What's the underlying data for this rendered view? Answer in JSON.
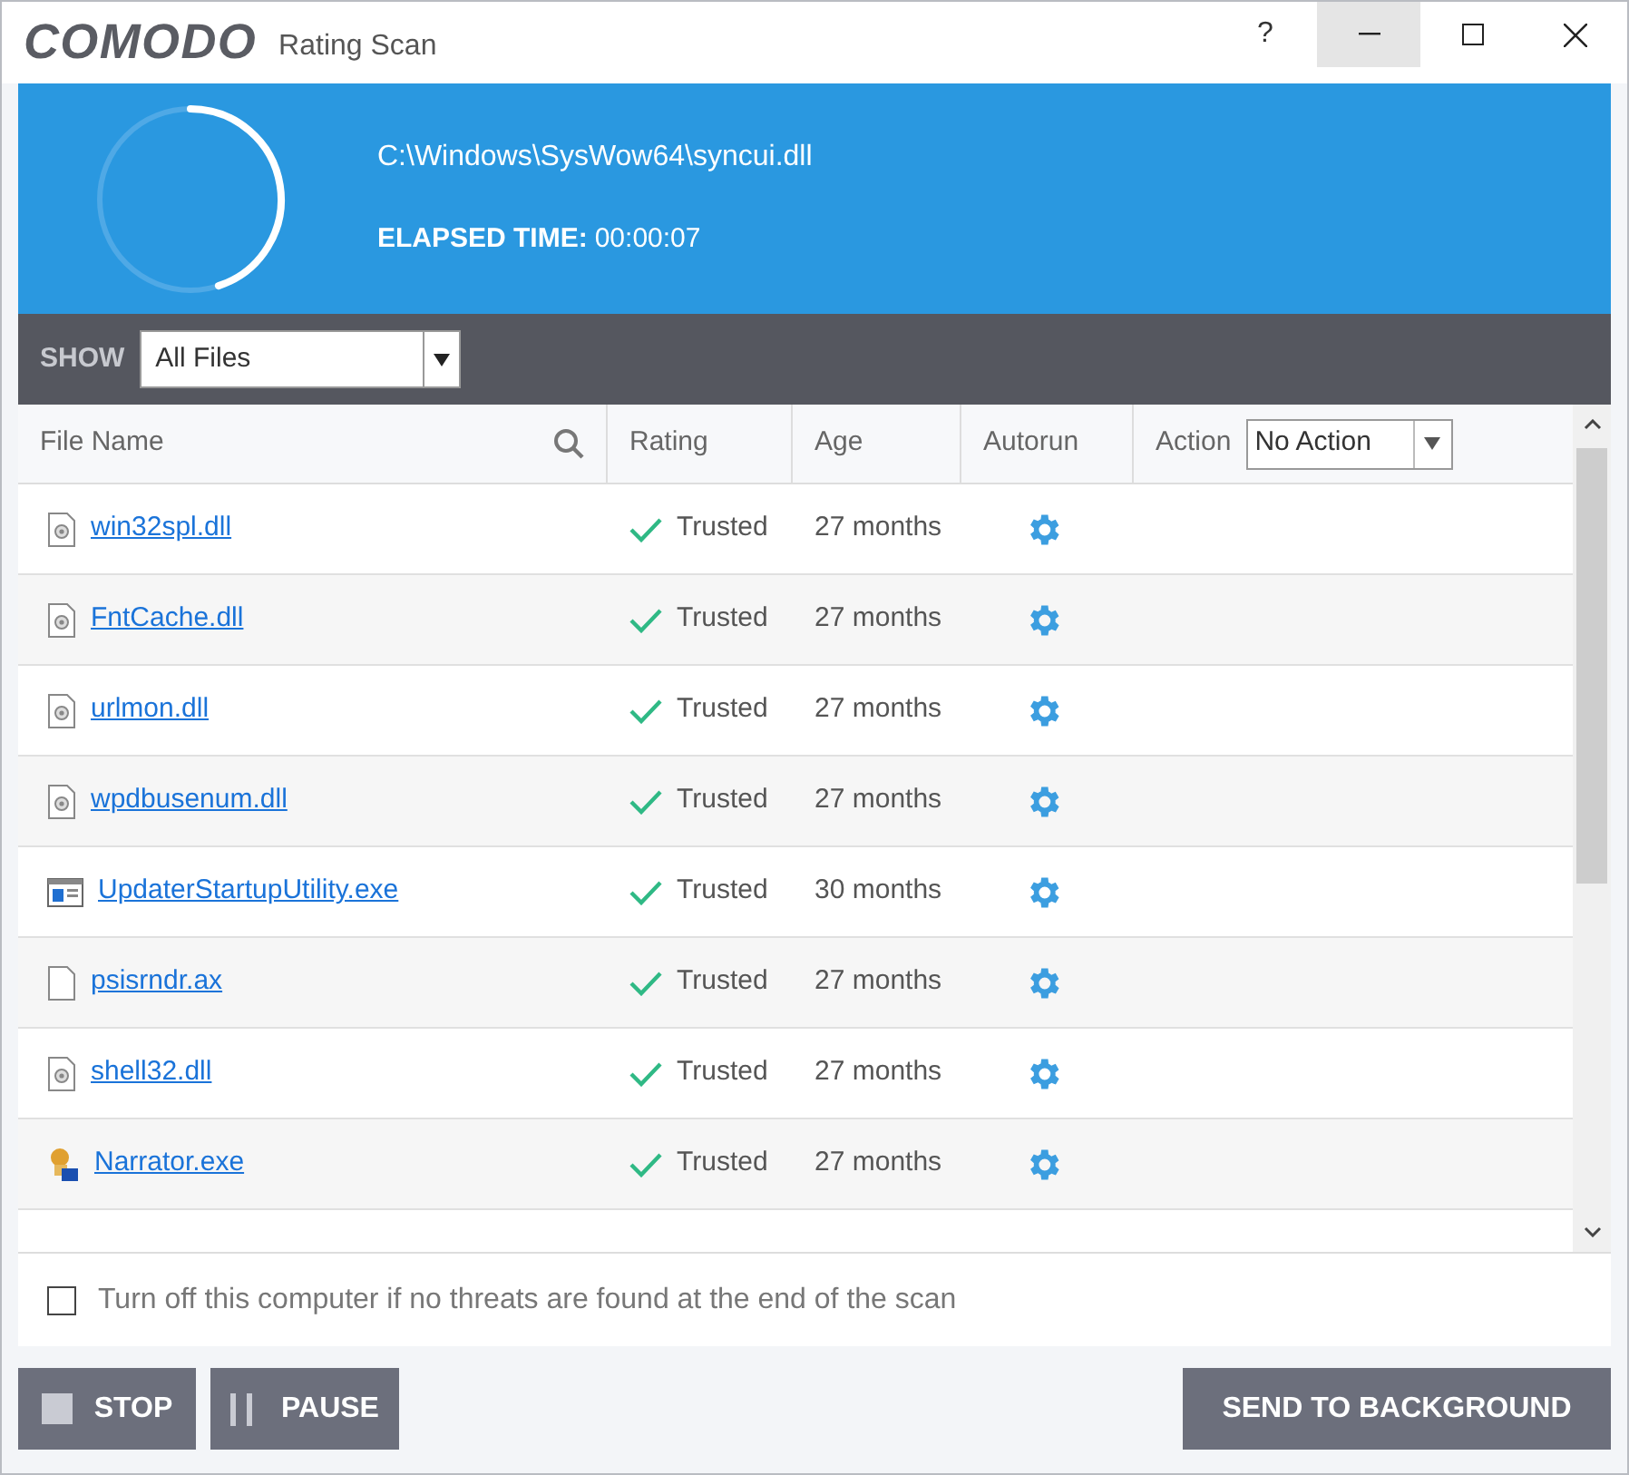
{
  "window": {
    "logo": "COMODO",
    "title": "Rating Scan",
    "help": "?"
  },
  "scan": {
    "level": 0.45,
    "current_file": "C:\\Windows\\SysWow64\\syncui.dll",
    "elapsed_label": "ELAPSED TIME:",
    "elapsed": "00:00:07"
  },
  "filter": {
    "label": "SHOW",
    "value": "All Files"
  },
  "table": {
    "columns": [
      "File Name",
      "Rating",
      "Age",
      "Autorun",
      "Action"
    ],
    "action_value": "No Action",
    "rows": [
      {
        "kind": "dll",
        "name": "win32spl.dll",
        "rating": "Trusted",
        "age": "27 months"
      },
      {
        "kind": "dll",
        "name": "FntCache.dll",
        "rating": "Trusted",
        "age": "27 months"
      },
      {
        "kind": "dll",
        "name": "urlmon.dll",
        "rating": "Trusted",
        "age": "27 months"
      },
      {
        "kind": "dll",
        "name": "wpdbusenum.dll",
        "rating": "Trusted",
        "age": "27 months"
      },
      {
        "kind": "app",
        "name": "UpdaterStartupUtility.exe",
        "rating": "Trusted",
        "age": "30 months"
      },
      {
        "kind": "blank",
        "name": "psisrndr.ax",
        "rating": "Trusted",
        "age": "27 months"
      },
      {
        "kind": "dll",
        "name": "shell32.dll",
        "rating": "Trusted",
        "age": "27 months"
      },
      {
        "kind": "person",
        "name": "Narrator.exe",
        "rating": "Trusted",
        "age": "27 months"
      }
    ]
  },
  "shutdown_option": {
    "label": "Turn off this computer if no threats are found at the end of the scan",
    "checked": false
  },
  "buttons": {
    "stop": "STOP",
    "pause": "PAUSE",
    "background": "SEND TO BACKGROUND"
  }
}
